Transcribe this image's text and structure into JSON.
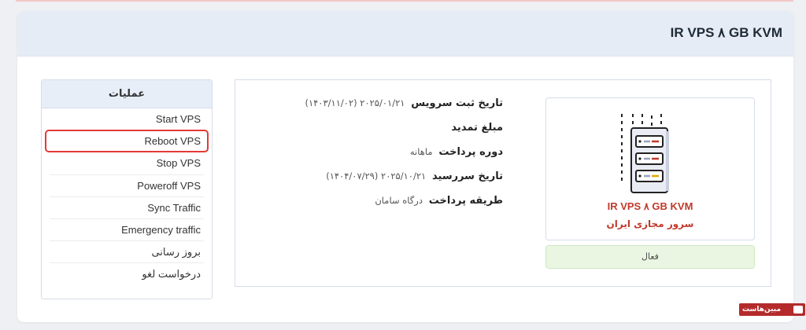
{
  "page": {
    "title": "IR VPS ۸ GB KVM"
  },
  "actions": {
    "heading": "عملیات",
    "items": [
      {
        "label": "Start VPS"
      },
      {
        "label": "Reboot VPS"
      },
      {
        "label": "Stop VPS"
      },
      {
        "label": "Poweroff VPS"
      },
      {
        "label": "Sync Traffic"
      },
      {
        "label": "Emergency traffic"
      },
      {
        "label": "بروز رسانی"
      },
      {
        "label": "درخواست لغو"
      }
    ]
  },
  "service_info": {
    "registration_label": "تاریخ ثبت سرویس",
    "registration_value": "۲۰۲۵/۰۱/۲۱ (۱۴۰۳/۱۱/۰۲)",
    "renewal_amount_label": "مبلغ تمدید",
    "billing_cycle_label": "دوره پرداخت",
    "billing_cycle_value": "ماهانه",
    "due_date_label": "تاریخ سررسید",
    "due_date_value": "۲۰۲۵/۱۰/۲۱ (۱۴۰۴/۰۷/۲۹)",
    "payment_method_label": "طریقه پرداخت",
    "payment_method_value": "درگاه سامان"
  },
  "product": {
    "name": "IR VPS ۸ GB KVM",
    "group": "سرور مجازی ایران",
    "status": "فعال",
    "icon": "server-rack-icon"
  },
  "brand": {
    "text": "مبین‌هاست",
    "color": "#b52b2b"
  },
  "colors": {
    "accent_red": "#c0392b",
    "highlight_border": "#e53935",
    "header_bg": "#e6ecf5",
    "status_bg": "#eaf6e2"
  }
}
